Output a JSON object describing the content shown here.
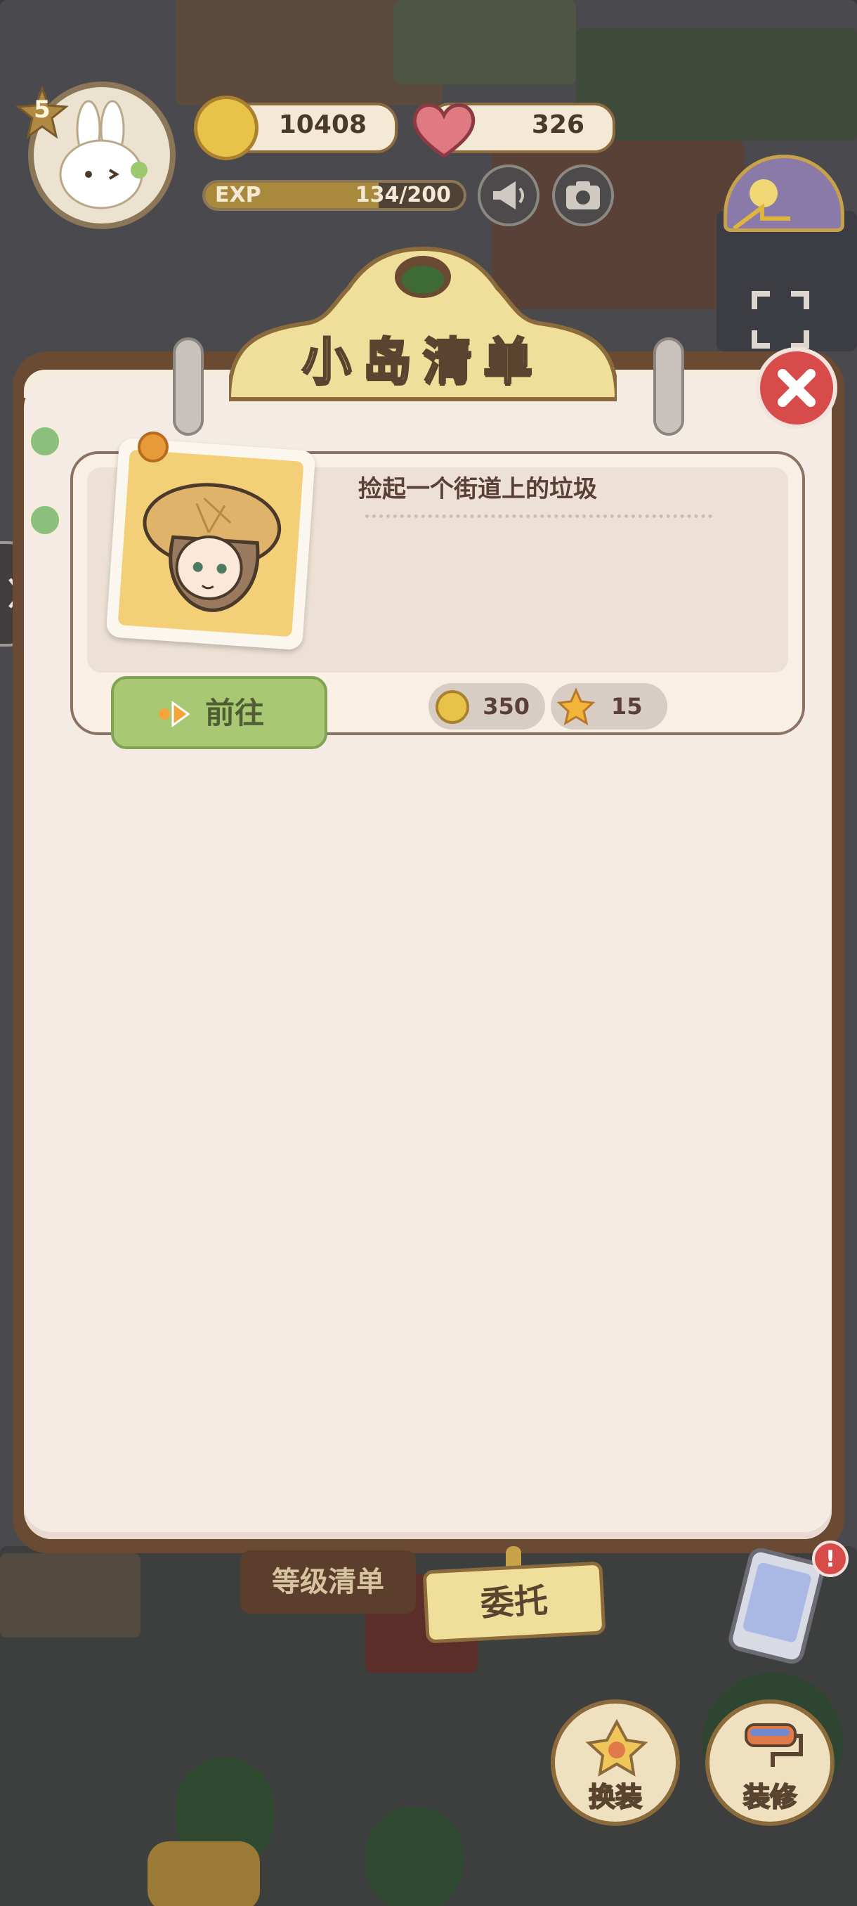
{
  "hud": {
    "level": "5",
    "coins": "10408",
    "hearts": "326",
    "exp_label": "EXP",
    "exp_current": "134",
    "exp_sep_total": "/200",
    "exp_progress": 0.67
  },
  "panel": {
    "title": "小岛清单",
    "task": {
      "description": "捡起一个街道上的垃圾",
      "go_label": "前往",
      "rewards": [
        {
          "icon": "coin-icon",
          "value": "350"
        },
        {
          "icon": "star-icon",
          "value": "15"
        }
      ]
    }
  },
  "tabs": {
    "level_list": "等级清单",
    "commission": "委托"
  },
  "actions": {
    "dress_up": "换装",
    "decorate": "装修"
  },
  "colors": {
    "panel_border": "#6b4a33",
    "panel_fill": "#f5ebe5",
    "close_red": "#d84b4b",
    "go_green": "#a8c874",
    "plate_yellow": "#f0df9a"
  }
}
